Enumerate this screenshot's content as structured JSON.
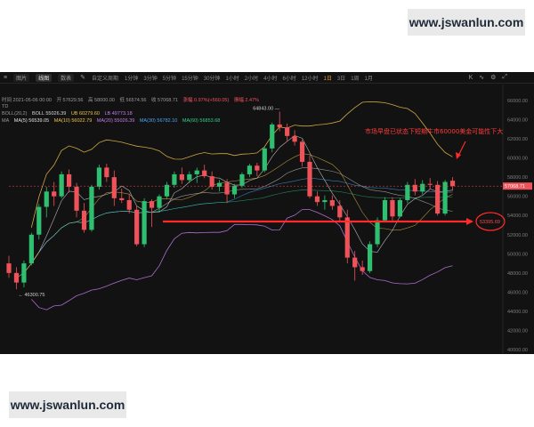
{
  "watermark": {
    "text": "www.jswanlun.com"
  },
  "toolbar": {
    "items": [
      "图片",
      "线图",
      "数表"
    ],
    "custom_label": "自定义周期",
    "intervals": [
      "1分钟",
      "3分钟",
      "5分钟",
      "15分钟",
      "30分钟",
      "1小时",
      "2小时",
      "4小时",
      "6小时",
      "12小时",
      "1日",
      "3日",
      "1周",
      "1月"
    ],
    "active_interval": "1日",
    "right_icons": [
      "K",
      "∿",
      "⚙",
      "⤢"
    ]
  },
  "info": {
    "time": "时间 2021-05-06 00:00",
    "open": "开 57629.56",
    "high": "高 58000.00",
    "low": "低 56574.56",
    "close": "收 57068.71",
    "change": "涨幅 0.97%(+560.05)",
    "amplitude": "振幅 2.47%"
  },
  "indicators": {
    "td": "TD",
    "boll_label": "BOLL(20,2)",
    "boll_mid": "BOLL 55026.39",
    "boll_ub": "UB 60279.60",
    "boll_lb": "LB 49773.18",
    "ma_label": "MA",
    "ma5": "MA(5) 56539.05",
    "ma10": "MA(10) 56022.79",
    "ma20": "MA(20) 55026.39",
    "ma30": "MA(30) 56782.10",
    "ma60": "MA(60) 56853.68"
  },
  "annotation": {
    "text": "市场早盘已状态下短期牛市60000美金可能性下大",
    "circled_value": "53395.69"
  },
  "colors": {
    "up": "#2fbf71",
    "down": "#f0525a",
    "ub": "#f0c24b",
    "lb": "#c87df0",
    "ma30": "#4aa8ff",
    "ma60": "#2fd28a"
  },
  "chart_data": {
    "type": "candlestick",
    "title": "",
    "ylim": [
      40000,
      66000
    ],
    "y_ticks": [
      40000,
      42000,
      44000,
      46000,
      48000,
      50000,
      52000,
      54000,
      56000,
      58000,
      60000,
      62000,
      64000,
      66000
    ],
    "y_tick_labels": [
      "40000.00",
      "42000.00",
      "44000.00",
      "46000.00",
      "48000.00",
      "50000.00",
      "52000.00",
      "54000.00",
      "56000.00",
      "58000.00",
      "60000.00",
      "62000.00",
      "64000.00",
      "66000.00"
    ],
    "annotated_low": "46300.75",
    "annotated_high": "64843.00",
    "last_price": "57068.71",
    "candles": [
      {
        "o": 49000,
        "h": 49800,
        "l": 47500,
        "c": 48000
      },
      {
        "o": 48000,
        "h": 48600,
        "l": 46300,
        "c": 47000
      },
      {
        "o": 47000,
        "h": 49300,
        "l": 46500,
        "c": 49000
      },
      {
        "o": 49000,
        "h": 52200,
        "l": 48800,
        "c": 52000
      },
      {
        "o": 52000,
        "h": 55200,
        "l": 51500,
        "c": 54900
      },
      {
        "o": 54900,
        "h": 57000,
        "l": 53800,
        "c": 56500
      },
      {
        "o": 56500,
        "h": 57500,
        "l": 55000,
        "c": 56000
      },
      {
        "o": 56000,
        "h": 58600,
        "l": 55800,
        "c": 58300
      },
      {
        "o": 58300,
        "h": 58800,
        "l": 56400,
        "c": 57000
      },
      {
        "o": 57000,
        "h": 57400,
        "l": 53800,
        "c": 54500
      },
      {
        "o": 54500,
        "h": 55300,
        "l": 52200,
        "c": 52500
      },
      {
        "o": 52500,
        "h": 57200,
        "l": 52300,
        "c": 57000
      },
      {
        "o": 57000,
        "h": 59300,
        "l": 56700,
        "c": 59000
      },
      {
        "o": 59000,
        "h": 59400,
        "l": 57500,
        "c": 58000
      },
      {
        "o": 58000,
        "h": 58700,
        "l": 55000,
        "c": 55800
      },
      {
        "o": 55800,
        "h": 56800,
        "l": 55300,
        "c": 55600
      },
      {
        "o": 55600,
        "h": 56200,
        "l": 54200,
        "c": 54600
      },
      {
        "o": 54600,
        "h": 55000,
        "l": 50800,
        "c": 51000
      },
      {
        "o": 51000,
        "h": 55800,
        "l": 50700,
        "c": 55500
      },
      {
        "o": 55500,
        "h": 55700,
        "l": 52800,
        "c": 54800
      },
      {
        "o": 54800,
        "h": 56200,
        "l": 54300,
        "c": 56000
      },
      {
        "o": 56000,
        "h": 57500,
        "l": 55800,
        "c": 57200
      },
      {
        "o": 57200,
        "h": 58600,
        "l": 56900,
        "c": 58300
      },
      {
        "o": 58300,
        "h": 59000,
        "l": 57300,
        "c": 57700
      },
      {
        "o": 57700,
        "h": 58600,
        "l": 57400,
        "c": 58300
      },
      {
        "o": 58300,
        "h": 59000,
        "l": 57400,
        "c": 58700
      },
      {
        "o": 58700,
        "h": 59300,
        "l": 57900,
        "c": 58100
      },
      {
        "o": 58100,
        "h": 58600,
        "l": 56700,
        "c": 57000
      },
      {
        "o": 57000,
        "h": 57700,
        "l": 56500,
        "c": 57400
      },
      {
        "o": 57400,
        "h": 57800,
        "l": 55300,
        "c": 56200
      },
      {
        "o": 56200,
        "h": 57300,
        "l": 55800,
        "c": 57100
      },
      {
        "o": 57100,
        "h": 58500,
        "l": 56900,
        "c": 58300
      },
      {
        "o": 58300,
        "h": 59400,
        "l": 58000,
        "c": 59200
      },
      {
        "o": 59200,
        "h": 59500,
        "l": 58100,
        "c": 58700
      },
      {
        "o": 58700,
        "h": 61200,
        "l": 58500,
        "c": 61000
      },
      {
        "o": 61000,
        "h": 63700,
        "l": 60600,
        "c": 63500
      },
      {
        "o": 63500,
        "h": 64843,
        "l": 62800,
        "c": 63200
      },
      {
        "o": 63200,
        "h": 63600,
        "l": 61800,
        "c": 62300
      },
      {
        "o": 62300,
        "h": 62900,
        "l": 61300,
        "c": 61700
      },
      {
        "o": 61700,
        "h": 61900,
        "l": 59100,
        "c": 59600
      },
      {
        "o": 59600,
        "h": 60300,
        "l": 55800,
        "c": 56000
      },
      {
        "o": 56000,
        "h": 56500,
        "l": 55000,
        "c": 55400
      },
      {
        "o": 55400,
        "h": 56100,
        "l": 54600,
        "c": 55600
      },
      {
        "o": 55600,
        "h": 56100,
        "l": 54600,
        "c": 55000
      },
      {
        "o": 55000,
        "h": 55600,
        "l": 53300,
        "c": 53800
      },
      {
        "o": 53800,
        "h": 54600,
        "l": 49000,
        "c": 49600
      },
      {
        "o": 49600,
        "h": 50300,
        "l": 47200,
        "c": 48600
      },
      {
        "o": 48600,
        "h": 49300,
        "l": 47800,
        "c": 48200
      },
      {
        "o": 48200,
        "h": 51300,
        "l": 48000,
        "c": 51000
      },
      {
        "o": 51000,
        "h": 53800,
        "l": 50700,
        "c": 53500
      },
      {
        "o": 53500,
        "h": 55900,
        "l": 53300,
        "c": 55600
      },
      {
        "o": 55600,
        "h": 55900,
        "l": 53500,
        "c": 53900
      },
      {
        "o": 53900,
        "h": 55800,
        "l": 53800,
        "c": 55600
      },
      {
        "o": 55600,
        "h": 57500,
        "l": 55300,
        "c": 57200
      },
      {
        "o": 57200,
        "h": 57800,
        "l": 56100,
        "c": 56500
      },
      {
        "o": 56500,
        "h": 57700,
        "l": 56200,
        "c": 57300
      },
      {
        "o": 57300,
        "h": 57900,
        "l": 56700,
        "c": 57200
      },
      {
        "o": 57200,
        "h": 57600,
        "l": 54000,
        "c": 54200
      },
      {
        "o": 54200,
        "h": 57700,
        "l": 54000,
        "c": 57500
      },
      {
        "o": 57629.56,
        "h": 58000,
        "l": 56574.56,
        "c": 57068.71
      }
    ]
  }
}
